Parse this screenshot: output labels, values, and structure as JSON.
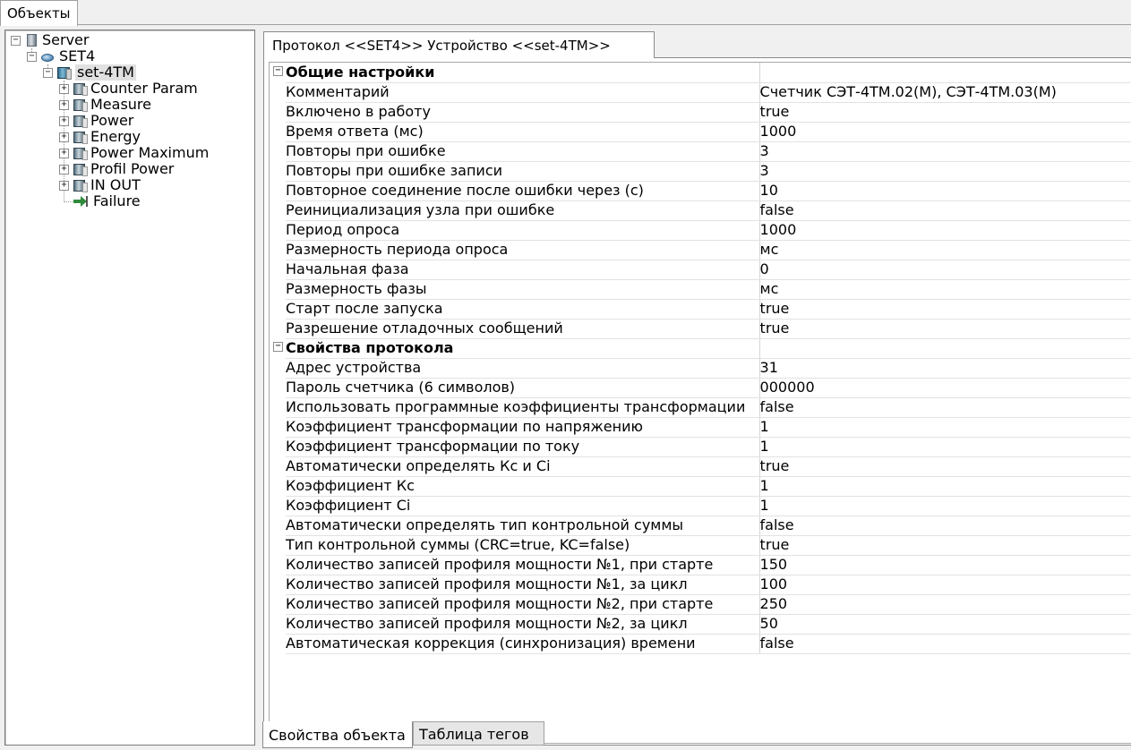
{
  "top_tab": "Объекты",
  "tree": {
    "server": "Server",
    "node": "SET4",
    "device": "set-4TM",
    "groups": [
      "Counter  Param",
      "Measure",
      "Power",
      "Energy",
      "Power  Maximum",
      "Profil  Power",
      "IN  OUT"
    ],
    "failure": "Failure",
    "expander_minus": "−",
    "expander_plus": "+"
  },
  "doc_tab": "Протокол <<SET4>> Устройство <<set-4TM>>",
  "properties": [
    {
      "category": "Общие настройки",
      "rows": [
        {
          "name": "Комментарий",
          "value": "Счетчик СЭТ-4ТМ.02(М), СЭТ-4ТМ.03(М)"
        },
        {
          "name": "Включено в работу",
          "value": "true"
        },
        {
          "name": "Время ответа (мс)",
          "value": "1000"
        },
        {
          "name": "Повторы при ошибке",
          "value": "3"
        },
        {
          "name": "Повторы при ошибке записи",
          "value": "3"
        },
        {
          "name": "Повторное соединение после ошибки через (с)",
          "value": "10"
        },
        {
          "name": "Реинициализация узла при ошибке",
          "value": "false"
        },
        {
          "name": "Период опроса",
          "value": "1000"
        },
        {
          "name": "Размерность периода опроса",
          "value": "мс"
        },
        {
          "name": "Начальная фаза",
          "value": "0"
        },
        {
          "name": "Размерность фазы",
          "value": "мс"
        },
        {
          "name": "Старт после запуска",
          "value": "true"
        },
        {
          "name": "Разрешение отладочных сообщений",
          "value": "true"
        }
      ]
    },
    {
      "category": "Свойства протокола",
      "rows": [
        {
          "name": "Адрес  устройства",
          "value": "31"
        },
        {
          "name": "Пароль счетчика (6 символов)",
          "value": "000000"
        },
        {
          "name": "Использовать программные коэффициенты трансформации",
          "value": "false"
        },
        {
          "name": "Коэффициент трансформации по напряжению",
          "value": "1"
        },
        {
          "name": "Коэффициент трансформации по току",
          "value": "1"
        },
        {
          "name": "Автоматически определять Кс и Ci",
          "value": "true"
        },
        {
          "name": "Коэффициент Кс",
          "value": "1"
        },
        {
          "name": "Коэффициент Ci",
          "value": "1"
        },
        {
          "name": "Автоматически определять тип контрольной суммы",
          "value": "false"
        },
        {
          "name": "Тип контрольной суммы (CRC=true, KC=false)",
          "value": "true"
        },
        {
          "name": "Количество записей профиля мощности №1, при старте",
          "value": "150"
        },
        {
          "name": "Количество записей профиля мощности №1, за цикл",
          "value": "100"
        },
        {
          "name": "Количество записей профиля мощности №2, при старте",
          "value": "250"
        },
        {
          "name": "Количество записей профиля мощности №2, за цикл",
          "value": "50"
        },
        {
          "name": "Автоматическая коррекция (синхронизация) времени",
          "value": "false"
        }
      ]
    }
  ],
  "bottom_tabs": [
    "Свойства объекта",
    "Таблица тегов"
  ],
  "colors": {
    "arrow_icon": "#2e8b3a",
    "selection": "#e1e1e1"
  }
}
